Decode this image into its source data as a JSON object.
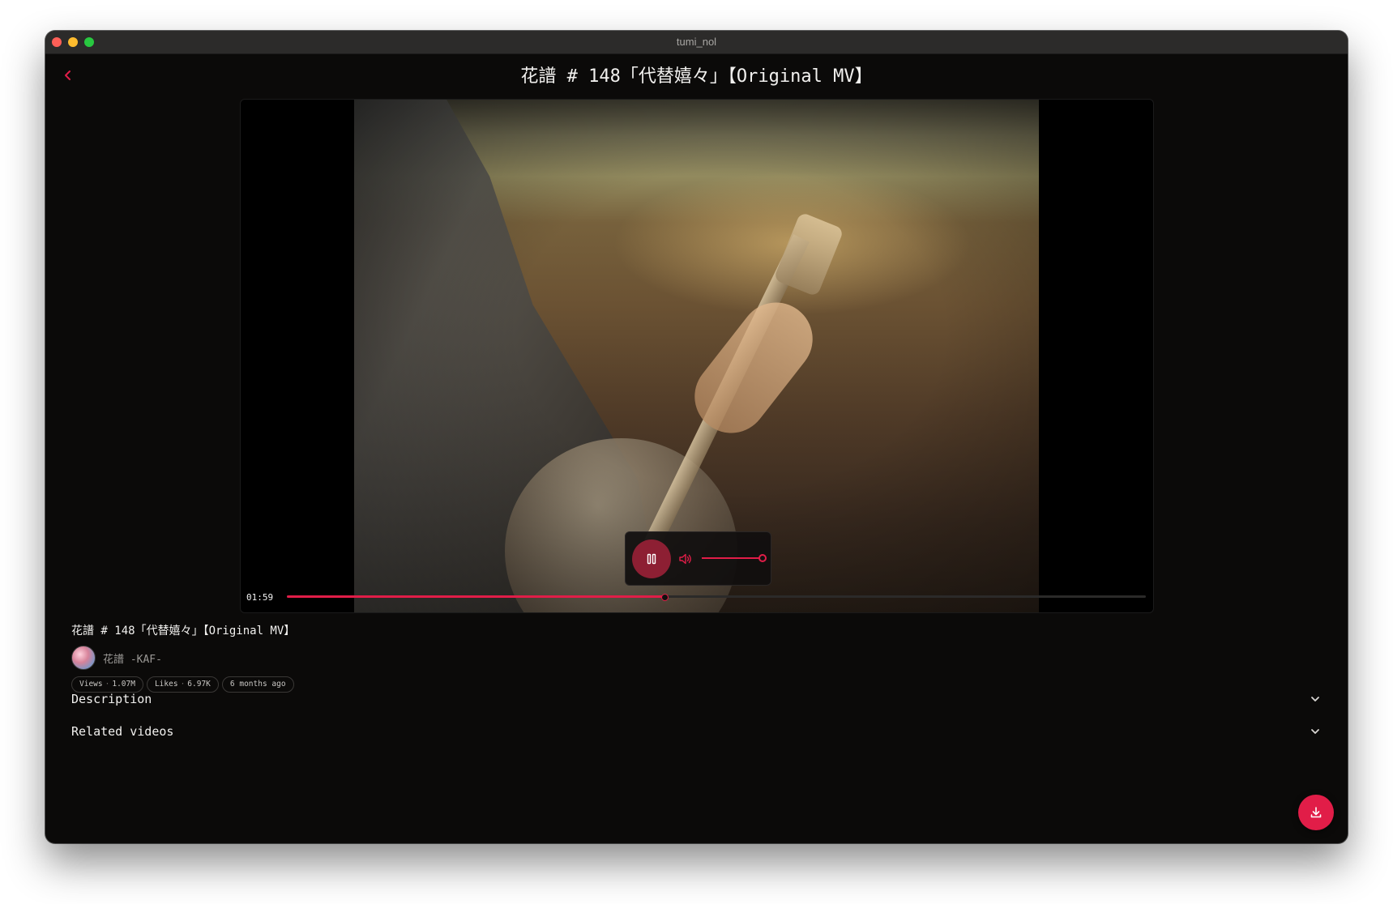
{
  "window": {
    "title": "tumi_nol"
  },
  "page": {
    "title": "花譜 # 148「代替嬉々」【Original MV】"
  },
  "player": {
    "current_time": "01:59",
    "progress": 0.44,
    "volume": 1.0,
    "state": "playing",
    "icons": {
      "playback": "pause-icon",
      "volume": "volume-icon"
    }
  },
  "video": {
    "title": "花譜 # 148「代替嬉々」【Original MV】",
    "channel": "花譜 -KAF-",
    "stats": [
      {
        "label": "Views",
        "value": "1.07M"
      },
      {
        "label": "Likes",
        "value": "6.97K"
      }
    ],
    "published": "6 months ago"
  },
  "sections": {
    "description": "Description",
    "related": "Related videos"
  },
  "actions": {
    "download_icon": "download-icon",
    "back_icon": "chevron-left-icon"
  },
  "colors": {
    "accent": "#e11d48",
    "background": "#0b0a09",
    "play_button": "#8d1f33"
  }
}
